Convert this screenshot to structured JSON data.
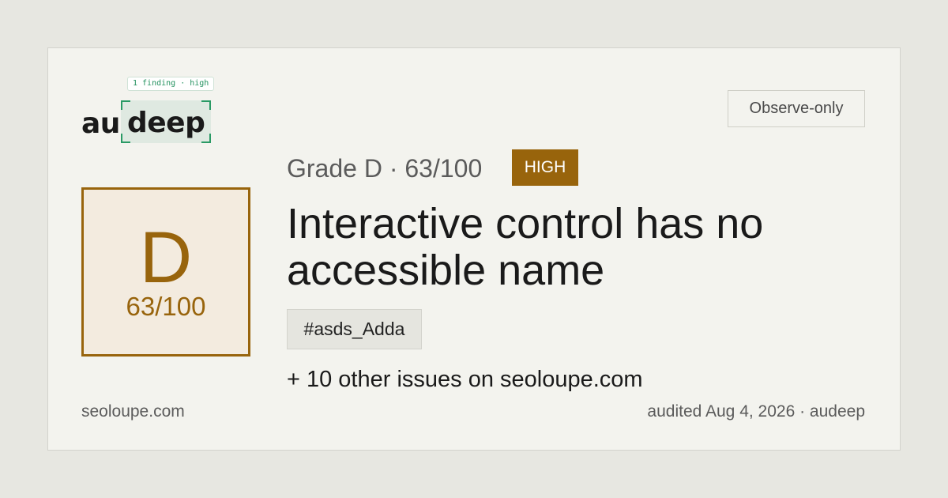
{
  "logo": {
    "badge": "1 finding · high",
    "prefix": "au",
    "highlight": "deep"
  },
  "header": {
    "observe_label": "Observe-only"
  },
  "grade": {
    "letter": "D",
    "score": "63/100",
    "line": "Grade D · 63/100",
    "severity": "HIGH"
  },
  "finding": {
    "title": "Interactive control has no accessible name",
    "selector": "#asds_Adda",
    "other_issues": "+ 10 other issues on seoloupe.com"
  },
  "footer": {
    "domain": "seoloupe.com",
    "audited": "audited Aug 4, 2026 · audeep"
  },
  "colors": {
    "accent_brown": "#98640c",
    "accent_green": "#2a9a65",
    "background": "#e7e7e1",
    "card": "#f3f3ee"
  }
}
